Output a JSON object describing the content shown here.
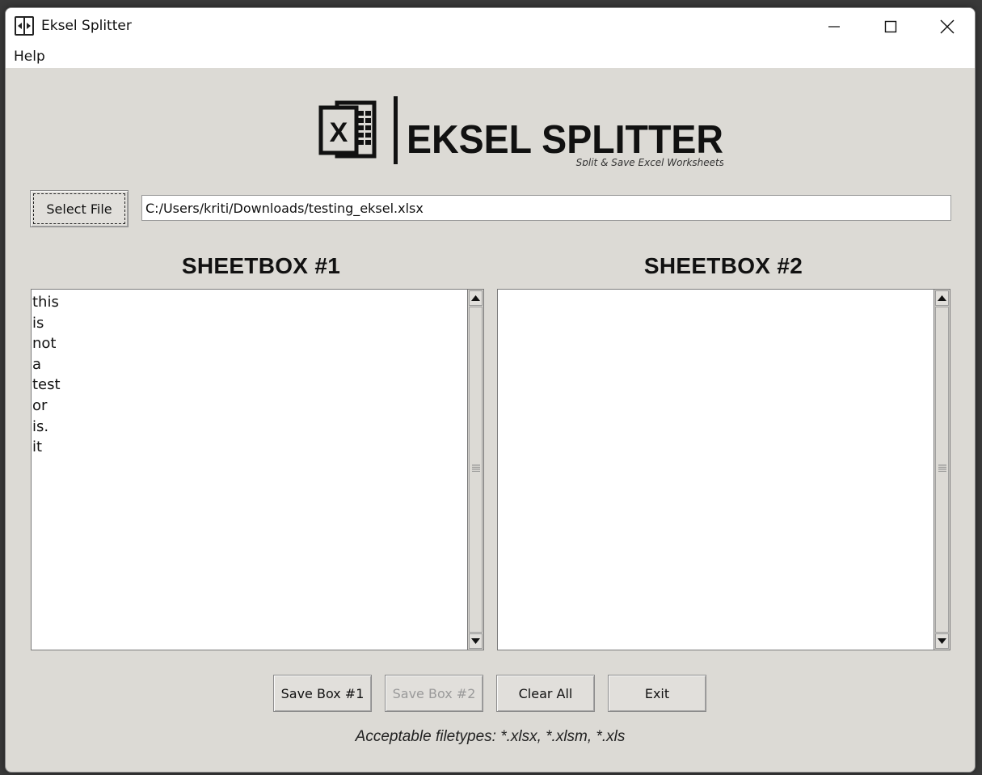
{
  "window": {
    "title": "Eksel Splitter",
    "icon": "eksel-app-icon"
  },
  "menu": {
    "help_label": "Help"
  },
  "logo": {
    "title": "EKSEL SPLITTER",
    "tagline": "Split & Save Excel Worksheets",
    "icon": "excel-file-icon"
  },
  "file": {
    "select_label": "Select File",
    "path_value": "C:/Users/kriti/Downloads/testing_eksel.xlsx"
  },
  "sheetbox1": {
    "title": "SHEETBOX #1",
    "items": [
      "this",
      "is",
      "not",
      "a",
      "test",
      "or",
      "is.",
      "it"
    ]
  },
  "sheetbox2": {
    "title": "SHEETBOX #2",
    "items": []
  },
  "buttons": {
    "save1_label": "Save Box #1",
    "save2_label": "Save Box #2",
    "clear_label": "Clear All",
    "exit_label": "Exit"
  },
  "footnote": "Acceptable filetypes: *.xlsx, *.xlsm, *.xls",
  "colors": {
    "window_bg": "#dcdad5",
    "titlebar_bg": "#ffffff",
    "disabled_text": "#9a9a9a"
  }
}
